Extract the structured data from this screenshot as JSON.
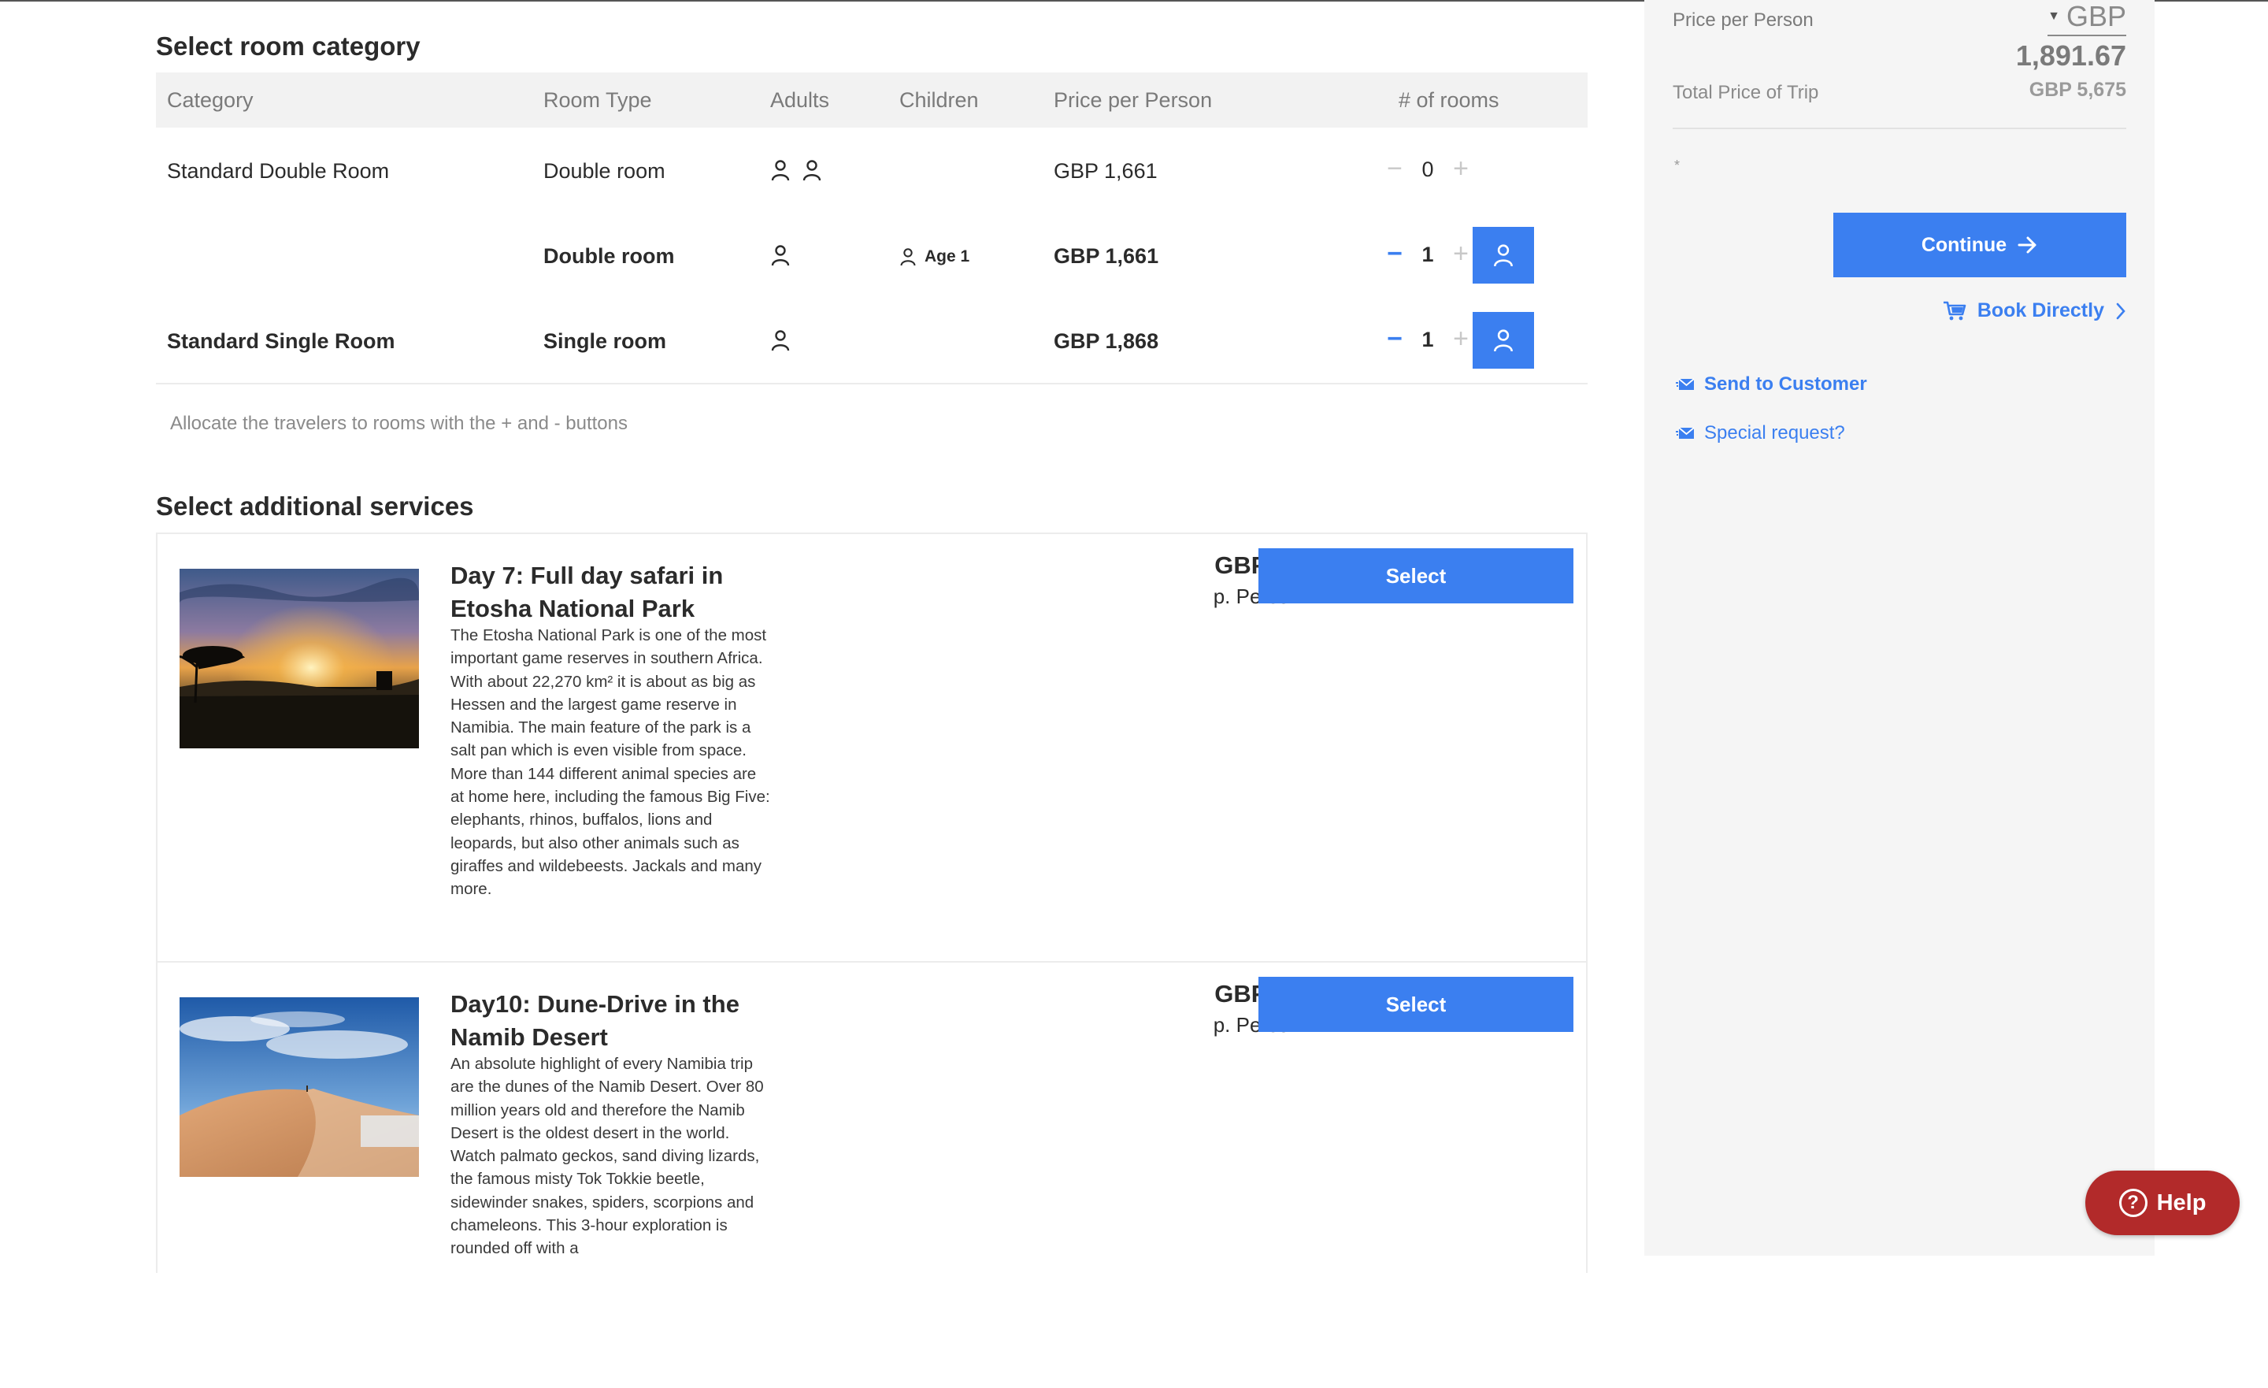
{
  "rooms": {
    "title": "Select room category",
    "headers": {
      "category": "Category",
      "room_type": "Room Type",
      "adults": "Adults",
      "children": "Children",
      "price": "Price per Person",
      "num_rooms": "# of rooms"
    },
    "rows": [
      {
        "category": "Standard Double Room",
        "type": "Double room",
        "adults": 2,
        "child": "",
        "price": "GBP 1,661",
        "count": "0"
      },
      {
        "category": "",
        "type": "Double room",
        "adults": 1,
        "child": "Age 1",
        "price": "GBP 1,661",
        "count": "1"
      },
      {
        "category": "Standard Single Room",
        "type": "Single room",
        "adults": 1,
        "child": "",
        "price": "GBP 1,868",
        "count": "1"
      }
    ],
    "hint": "Allocate the travelers to rooms with the + and - buttons"
  },
  "services": {
    "title": "Select additional services",
    "items": [
      {
        "title": "Day 7: Full day safari in Etosha National Park",
        "description": "The Etosha National Park is one of the most important game reserves in southern Africa. With about 22,270 km² it is about as big as Hessen and the largest game reserve in Namibia. The main feature of the park is a salt pan which is even visible from space. More than 144 different animal species are at home here, including the famous Big Five: elephants, rhinos, buffalos, lions and leopards, but also other animals such as giraffes and wildebeests. Jackals and many more.",
        "price": "GBP 87",
        "per": "p. Person",
        "select_label": "Select"
      },
      {
        "title": "Day10: Dune-Drive in the Namib Desert",
        "description": "An absolute highlight of every Namibia trip are the dunes of the Namib Desert. Over 80 million years old and therefore the Namib Desert is the oldest desert in the world. Watch palmato geckos, sand diving lizards, the famous misty Tok Tokkie beetle, sidewinder snakes, spiders, scorpions and chameleons. This 3-hour exploration is rounded off with a",
        "price": "GBP 62",
        "per": "p. Person",
        "select_label": "Select"
      }
    ]
  },
  "sidebar": {
    "price_per_person_label": "Price per Person",
    "currency": "GBP",
    "price_per_person_value": "1,891.67",
    "total_label": "Total Price of Trip",
    "total_value": "GBP 5,675",
    "dot": "*",
    "continue_label": "Continue",
    "book_directly_label": "Book Directly",
    "send_label": "Send to Customer",
    "special_label": "Special request?"
  },
  "help": {
    "label": "Help",
    "icon_glyph": "?"
  },
  "icons": {
    "person": "person-icon",
    "minus": "minus-icon",
    "plus": "plus-icon",
    "cart": "cart-icon",
    "arrow": "arrow-right-icon",
    "mail": "mail-icon",
    "chevron": "chevron-right-icon"
  },
  "colors": {
    "accent": "#3b7ff0",
    "help": "#b22a2a",
    "sidebar_bg": "#f5f5f5"
  }
}
